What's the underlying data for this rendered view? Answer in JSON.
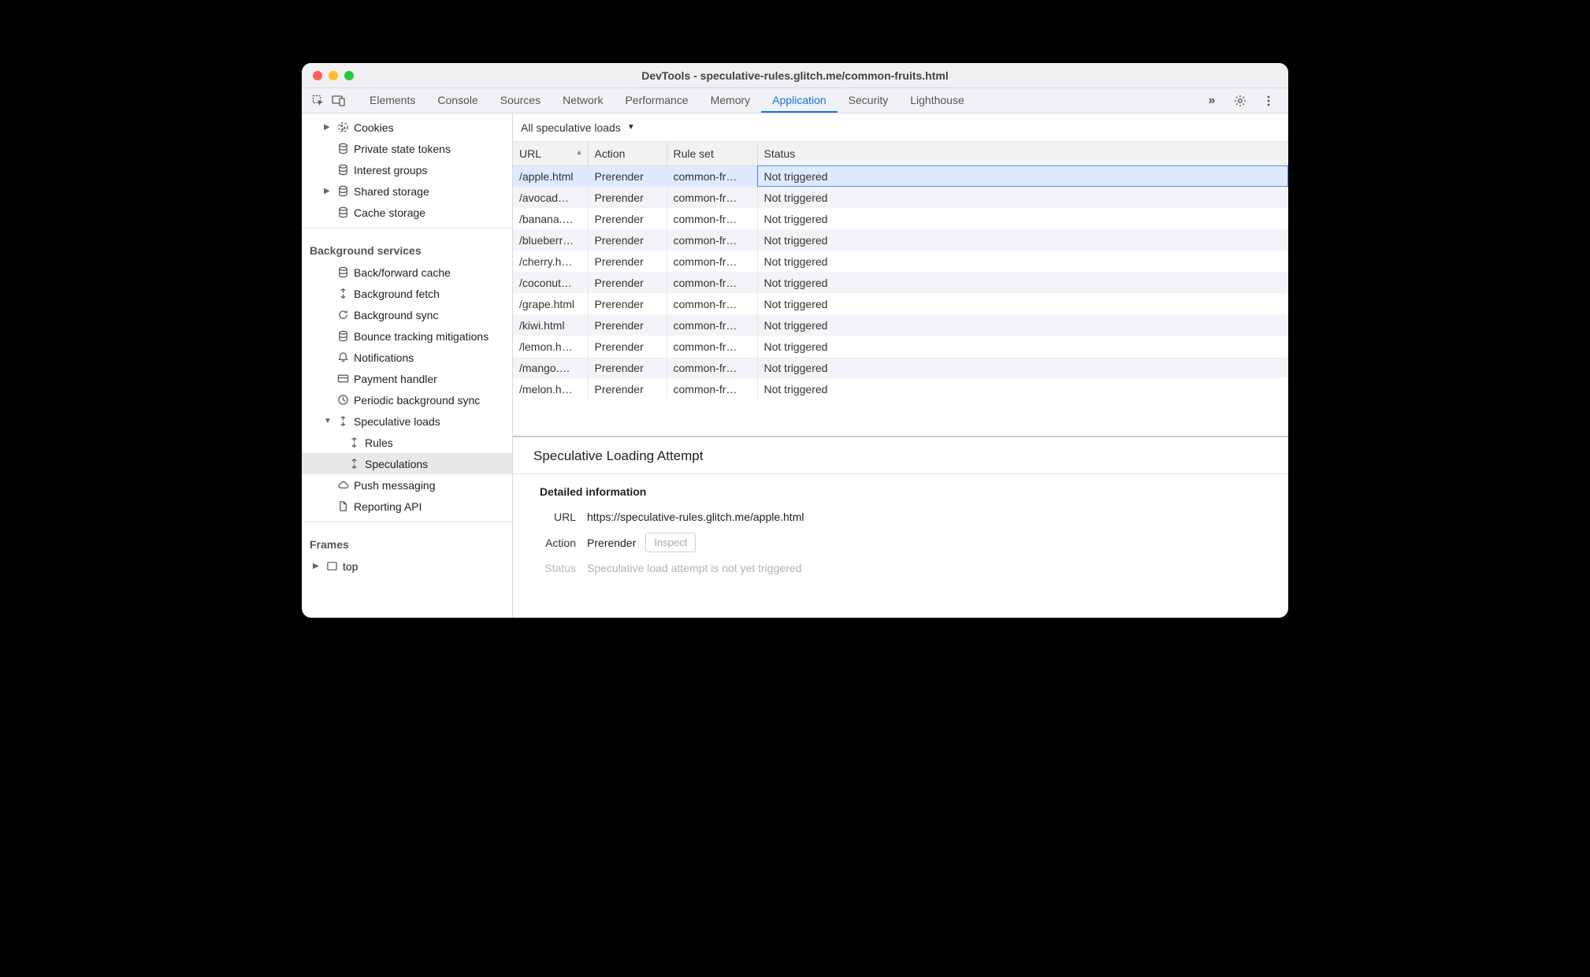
{
  "window": {
    "title": "DevTools - speculative-rules.glitch.me/common-fruits.html"
  },
  "tabs": {
    "items": [
      "Elements",
      "Console",
      "Sources",
      "Network",
      "Performance",
      "Memory",
      "Application",
      "Security",
      "Lighthouse"
    ],
    "active": "Application"
  },
  "sidebar": {
    "storage": {
      "items": [
        {
          "label": "Cookies",
          "icon": "cookie",
          "expandable": true
        },
        {
          "label": "Private state tokens",
          "icon": "db"
        },
        {
          "label": "Interest groups",
          "icon": "db"
        },
        {
          "label": "Shared storage",
          "icon": "db",
          "expandable": true
        },
        {
          "label": "Cache storage",
          "icon": "db"
        }
      ]
    },
    "bg_head": "Background services",
    "bg": {
      "items": [
        {
          "label": "Back/forward cache",
          "icon": "db"
        },
        {
          "label": "Background fetch",
          "icon": "sync"
        },
        {
          "label": "Background sync",
          "icon": "refresh"
        },
        {
          "label": "Bounce tracking mitigations",
          "icon": "db"
        },
        {
          "label": "Notifications",
          "icon": "bell"
        },
        {
          "label": "Payment handler",
          "icon": "card"
        },
        {
          "label": "Periodic background sync",
          "icon": "clock"
        },
        {
          "label": "Speculative loads",
          "icon": "sync",
          "expandable": true,
          "expanded": true,
          "children": [
            {
              "label": "Rules",
              "icon": "sync"
            },
            {
              "label": "Speculations",
              "icon": "sync",
              "selected": true
            }
          ]
        },
        {
          "label": "Push messaging",
          "icon": "cloud"
        },
        {
          "label": "Reporting API",
          "icon": "doc"
        }
      ]
    },
    "frames_head": "Frames",
    "frames": {
      "items": [
        {
          "label": "top",
          "icon": "frame",
          "expandable": true
        }
      ]
    }
  },
  "filter": {
    "label": "All speculative loads"
  },
  "table": {
    "columns": [
      "URL",
      "Action",
      "Rule set",
      "Status"
    ],
    "rows": [
      {
        "url": "/apple.html",
        "action": "Prerender",
        "ruleset": "common-fr…",
        "status": "Not triggered",
        "selected": true
      },
      {
        "url": "/avocad…",
        "action": "Prerender",
        "ruleset": "common-fr…",
        "status": "Not triggered"
      },
      {
        "url": "/banana.…",
        "action": "Prerender",
        "ruleset": "common-fr…",
        "status": "Not triggered"
      },
      {
        "url": "/blueberr…",
        "action": "Prerender",
        "ruleset": "common-fr…",
        "status": "Not triggered"
      },
      {
        "url": "/cherry.h…",
        "action": "Prerender",
        "ruleset": "common-fr…",
        "status": "Not triggered"
      },
      {
        "url": "/coconut…",
        "action": "Prerender",
        "ruleset": "common-fr…",
        "status": "Not triggered"
      },
      {
        "url": "/grape.html",
        "action": "Prerender",
        "ruleset": "common-fr…",
        "status": "Not triggered"
      },
      {
        "url": "/kiwi.html",
        "action": "Prerender",
        "ruleset": "common-fr…",
        "status": "Not triggered"
      },
      {
        "url": "/lemon.h…",
        "action": "Prerender",
        "ruleset": "common-fr…",
        "status": "Not triggered"
      },
      {
        "url": "/mango.…",
        "action": "Prerender",
        "ruleset": "common-fr…",
        "status": "Not triggered"
      },
      {
        "url": "/melon.h…",
        "action": "Prerender",
        "ruleset": "common-fr…",
        "status": "Not triggered"
      }
    ]
  },
  "details": {
    "heading": "Speculative Loading Attempt",
    "sub": "Detailed information",
    "url_label": "URL",
    "url_value": "https://speculative-rules.glitch.me/apple.html",
    "action_label": "Action",
    "action_value": "Prerender",
    "inspect_label": "Inspect",
    "status_label": "Status",
    "status_value": "Speculative load attempt is not yet triggered"
  }
}
